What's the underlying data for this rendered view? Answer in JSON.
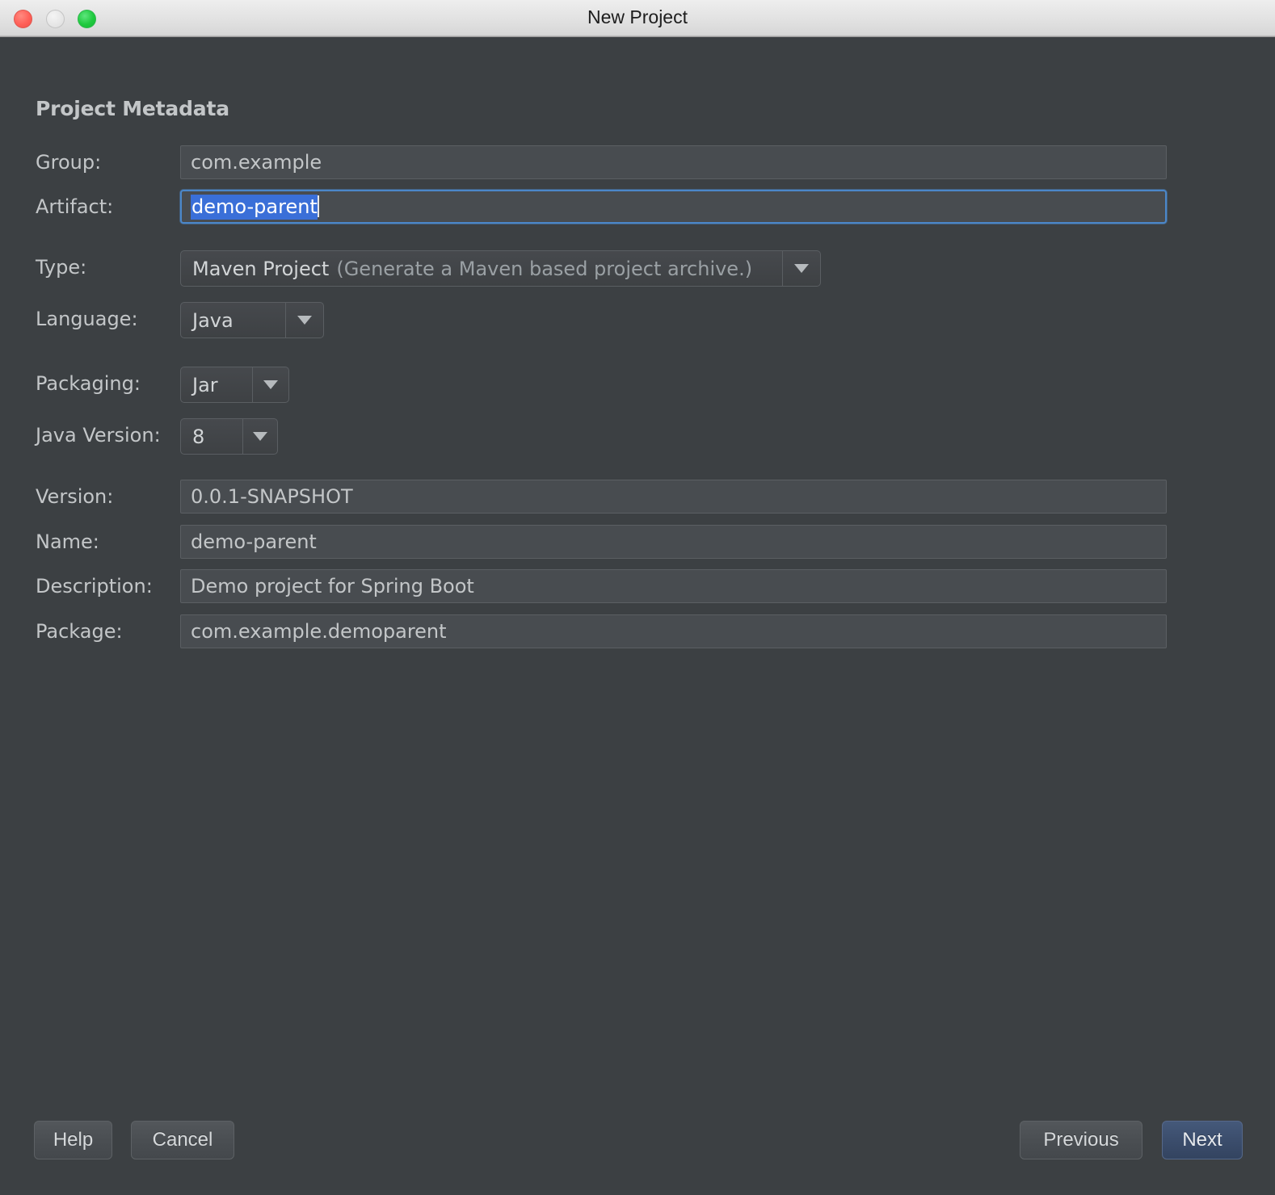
{
  "window": {
    "title": "New Project",
    "traffic_lights": [
      "close-button",
      "minimize-button",
      "maximize-button"
    ]
  },
  "page": {
    "heading": "Project Metadata"
  },
  "form": {
    "group": {
      "label": "Group:",
      "value": "com.example"
    },
    "artifact": {
      "label": "Artifact:",
      "value": "demo-parent",
      "selected": true,
      "focused": true
    },
    "type": {
      "label": "Type:",
      "value": "Maven Project",
      "hint": "(Generate a Maven based project archive.)"
    },
    "language": {
      "label": "Language:",
      "value": "Java"
    },
    "packaging": {
      "label": "Packaging:",
      "value": "Jar"
    },
    "java_version": {
      "label": "Java Version:",
      "value": "8"
    },
    "version": {
      "label": "Version:",
      "value": "0.0.1-SNAPSHOT"
    },
    "name": {
      "label": "Name:",
      "value": "demo-parent"
    },
    "description": {
      "label": "Description:",
      "value": "Demo project for Spring Boot"
    },
    "package": {
      "label": "Package:",
      "value": "com.example.demoparent"
    }
  },
  "buttons": {
    "help": "Help",
    "cancel": "Cancel",
    "previous": "Previous",
    "next": "Next"
  },
  "colors": {
    "dialog_background": "#3c4043",
    "field_background": "#484c50",
    "text": "#c3c6c8",
    "dim_text": "#9aa0a4",
    "focus_border": "#4b87c9",
    "selection": "#3a6fd8",
    "primary_button": "#3b4d6c"
  }
}
